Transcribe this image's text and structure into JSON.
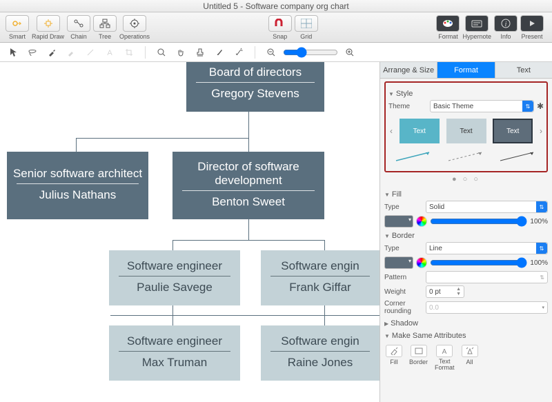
{
  "title": "Untitled 5 - Software company org chart",
  "toolbar": {
    "smart": "Smart",
    "rapid": "Rapid Draw",
    "chain": "Chain",
    "tree": "Tree",
    "operations": "Operations",
    "snap": "Snap",
    "grid": "Grid",
    "format": "Format",
    "hypernote": "Hypernote",
    "info": "Info",
    "present": "Present"
  },
  "tabs": {
    "arrange": "Arrange & Size",
    "format": "Format",
    "text": "Text"
  },
  "sections": {
    "style": "Style",
    "fill": "Fill",
    "border": "Border",
    "shadow": "Shadow",
    "msa": "Make Same Attributes",
    "theme_label": "Theme",
    "type_label": "Type",
    "pattern_label": "Pattern",
    "weight_label": "Weight",
    "corner_label": "Corner rounding"
  },
  "values": {
    "theme": "Basic Theme",
    "fill_type": "Solid",
    "fill_pct": "100%",
    "border_type": "Line",
    "border_pct": "100%",
    "weight": "0 pt",
    "corner": "0.0",
    "swatch_text": "Text"
  },
  "attr": {
    "fill": "Fill",
    "border": "Border",
    "textfmt": "Text\nFormat",
    "all": "All"
  },
  "chart": {
    "board_title": "Board of directors",
    "board_name": "Gregory Stevens",
    "arch_title": "Senior software architect",
    "arch_name": "Julius Nathans",
    "dir_title": "Director of software development",
    "dir_name": "Benton Sweet",
    "se": "Software engineer",
    "se_cut": "Software engin",
    "p1": "Paulie Savege",
    "p2": "Frank Giffar",
    "p3": "Max Truman",
    "p4": "Raine Jones"
  }
}
